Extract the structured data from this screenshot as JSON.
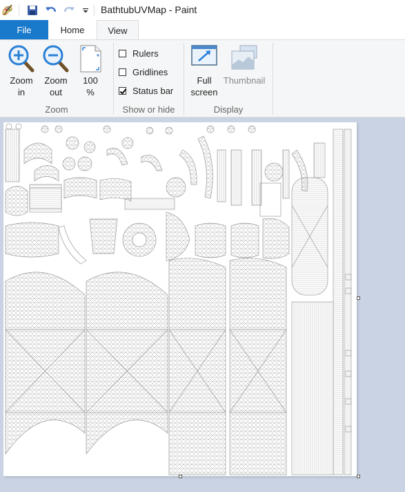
{
  "window": {
    "title": "BathtubUVMap - Paint"
  },
  "quick_access": [
    {
      "name": "paint-app-icon"
    },
    {
      "name": "save-icon"
    },
    {
      "name": "undo-icon"
    },
    {
      "name": "redo-icon"
    },
    {
      "name": "customize-quick-access-icon"
    }
  ],
  "tabs": {
    "file": "File",
    "home": "Home",
    "view": "View"
  },
  "ribbon": {
    "zoom": {
      "zoom_in": [
        "Zoom",
        "in"
      ],
      "zoom_out": [
        "Zoom",
        "out"
      ],
      "hundred": [
        "100",
        "%"
      ],
      "group": "Zoom"
    },
    "show_or_hide": {
      "rulers": {
        "label": "Rulers",
        "checked": false
      },
      "gridlines": {
        "label": "Gridlines",
        "checked": false
      },
      "status_bar": {
        "label": "Status bar",
        "checked": true
      },
      "group": "Show or hide"
    },
    "display": {
      "full_screen": [
        "Full",
        "screen"
      ],
      "thumbnail": "Thumbnail",
      "group": "Display"
    }
  },
  "colors": {
    "accent": "#1979ca",
    "ribbon_bg": "#f5f6f7",
    "workspace_bg": "#c9d3e4",
    "zoom_icon": "#2a7fd6"
  }
}
